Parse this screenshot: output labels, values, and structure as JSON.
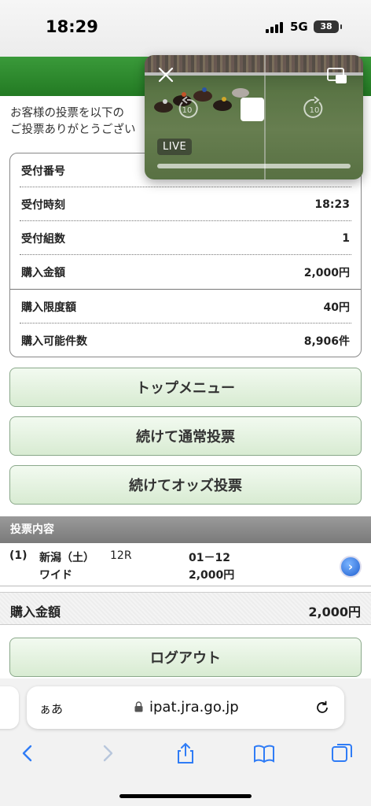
{
  "status_bar": {
    "time": "18:29",
    "network": "5G",
    "battery": "38"
  },
  "intro": {
    "line1": "お客様の投票を以下の",
    "line2": "ご投票ありがとうござい"
  },
  "receipt": {
    "rows": [
      {
        "label": "受付番号",
        "value": ""
      },
      {
        "label": "受付時刻",
        "value": "18:23"
      },
      {
        "label": "受付組数",
        "value": "1"
      },
      {
        "label": "購入金額",
        "value": "2,000円"
      },
      {
        "label": "購入限度額",
        "value": "40円"
      },
      {
        "label": "購入可能件数",
        "value": "8,906件"
      }
    ]
  },
  "buttons": {
    "top_menu": "トップメニュー",
    "continue_normal": "続けて通常投票",
    "continue_odds": "続けてオッズ投票",
    "logout": "ログアウト"
  },
  "vote_section": {
    "title": "投票内容",
    "items": [
      {
        "index": "(1)",
        "venue": "新潟（土）",
        "race": "12R",
        "combination": "01－12",
        "bet_type": "ワイド",
        "amount": "2,000円"
      }
    ],
    "total_label": "購入金額",
    "total_value": "2,000円"
  },
  "video": {
    "live_label": "LIVE",
    "skip_seconds": "10"
  },
  "browser": {
    "aa_label": "ぁあ",
    "url": "ipat.jra.go.jp"
  },
  "colors": {
    "header_green": "#2e8b2e",
    "button_green": "#dcefd6",
    "section_gray": "#8a8a8a",
    "ios_blue": "#2f7cf6"
  }
}
